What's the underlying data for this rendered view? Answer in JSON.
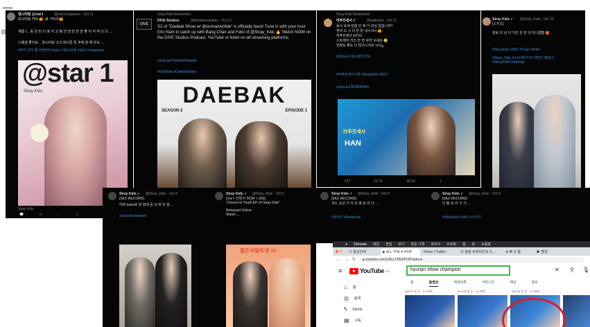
{
  "edge": {
    "text": "os",
    "bar": "—"
  },
  "tweet1": {
    "user": "앵스타팅 @star1",
    "handle": "@star1magazine · Oct 11",
    "line1": "보스타팅 커버 🍊 ✨ 가이즈🍊",
    "body1": "계룡 f... 등 한 만 이 표 지 고 평 전 대 전 한 한 좋 이 석 역 다 다 ...",
    "body2": "스페셜 좋이로... 양스타팅 고고 데이준 뜻 부에 원 해 유요 ...",
    "link1": "#러키 선다 좋 #한바닥 #star1 #앵스타팅 #SKZ #magazine",
    "cover_logo": "@star 1",
    "cover_sub": "Stray Kids",
    "footer": "Stray Kids"
  },
  "tweet2": {
    "retweet": "Stray Kids Retweeted",
    "user": "DIVE Studios",
    "handle": "@thediveestudios · Oct 12",
    "body": "S2 of \"Daebak Show w/ @eronamsHide\" is officially back! Tune in with your host Eric Nam to catch up with Bang Chan and Felix of @Stray_Kids 🔥 Watch NOW on the DIVE Studios Podcast, YouTube or listen on all streaming platforms.",
    "link": "youtu.be/TheRealDaebak",
    "tags": "#EricNam #DaebakShow",
    "show_title": "DAEBAK",
    "season": "SEASON 2",
    "episode": "EPISODE 1"
  },
  "tweet3": {
    "retweet": "Stray Kids Retweeted",
    "user": "라푸진세사 ✓",
    "handle": "@radiostar · Oct 11",
    "body1": "육사 요새 엄청 인 재 가 관심 없습니까?",
    "body2": "엄의 오 시 다 한 장 내시 8시 🍊",
    "body3": "라푸진세사 EP.32",
    "body4": "스트레이 키즈 한 련 보러 오세요 😊",
    "body5": "한참도 확도 다 많으니까요 ٩(ᐛ)و",
    "mentions": "@Stray Kids @한 P.M",
    "tags": "#라푸진세사 #한 #StrayKids #SKZ",
    "link": "youtu.be/DE5BKM6U",
    "show_label": "라푸진세사",
    "name_tag": "HAN",
    "stats": [
      "271",
      "15.1K",
      "40.1K",
      "⇪"
    ]
  },
  "tweet4": {
    "user": "Stray Kids ✓",
    "handle": "@Stray_Kids · Oct 10",
    "line1": "[스키즈]",
    "body1": "장로 이 남 이 가진 것 한 것 미니앨범 🎁",
    "body2": "#StrayKids #SKZ #Chan #Felix",
    "tags": "#Stray_Kids #스트레이키즈 #방찬 #필릭스 #StrayKidsChallenge"
  },
  "tweet5": {
    "user": "Stray Kids ✓",
    "handle": "@Stray_Kids · Oct 9",
    "line1": "[SKZ-RECORD]",
    "body": "아바 team로 양 엄데 윤 요 바 민 음 ...",
    "link": "youtu.be/example"
  },
  "tweet6": {
    "user": "Stray Kids ✓",
    "handle": "@Stray_Kids · Oct 9",
    "line1": "(n/a = 진연사 최대4 < 250)",
    "line2": "\"Cheers to Youth EP. of Stray Kids\"",
    "body": "Released Online\nWatch ...",
    "magazine": "월간 비밀의 방 #3"
  },
  "tweet7": {
    "user": "Stray Kids ✓",
    "handle": "@Stray_Kids · Oct 8",
    "line1": "[SKZ-RECORD]",
    "body": "코드 소년 기 어 요 앰 모 리 다 ...",
    "link": "#한치나 #StrayKids"
  },
  "tweet8": {
    "user": "Stray Kids ✓",
    "handle": "@Stray_Kids · Oct 8",
    "line1": "[SKZ-RECORD]",
    "body": "다 돌 모 아 기 가 ...",
    "tags": "#StrayKids #SKZ #스키즈"
  },
  "browser": {
    "menu": [
      "Chrome",
      "파일",
      "편집",
      "보기",
      "방문 기록",
      "북마크",
      "프로필",
      "탭",
      "창",
      "도움말"
    ],
    "tabs": [
      "⊙ 몽상당례",
      "▶ ALL THE K-POP",
      "Home / Twitter",
      "▣ 올림·포레럭잔네 즈...",
      "⊛ 뻐 오 물",
      "▶ 헬셋"
    ],
    "url": "youtube.com/c/ALLTHEKPOP/videos",
    "search_value": "hyunjin show champion",
    "brand": "YouTube",
    "brand_suffix": "KR",
    "nav": [
      "홈",
      "탐색",
      "Shorts",
      "구독"
    ],
    "channel_tabs": [
      "홈",
      "동영상",
      "재생목록",
      "커뮤니티",
      "채널",
      "정보"
    ],
    "active_tab": "동영상",
    "sort_labels": [
      "0952고 등 무 · 3.4 취까",
      "6712교 등 무 · 3.4 취까",
      "3312교 등 무 · 3.4 취까"
    ],
    "highlight_color": "#d61f2a",
    "search_box_color": "#3fb64a"
  }
}
